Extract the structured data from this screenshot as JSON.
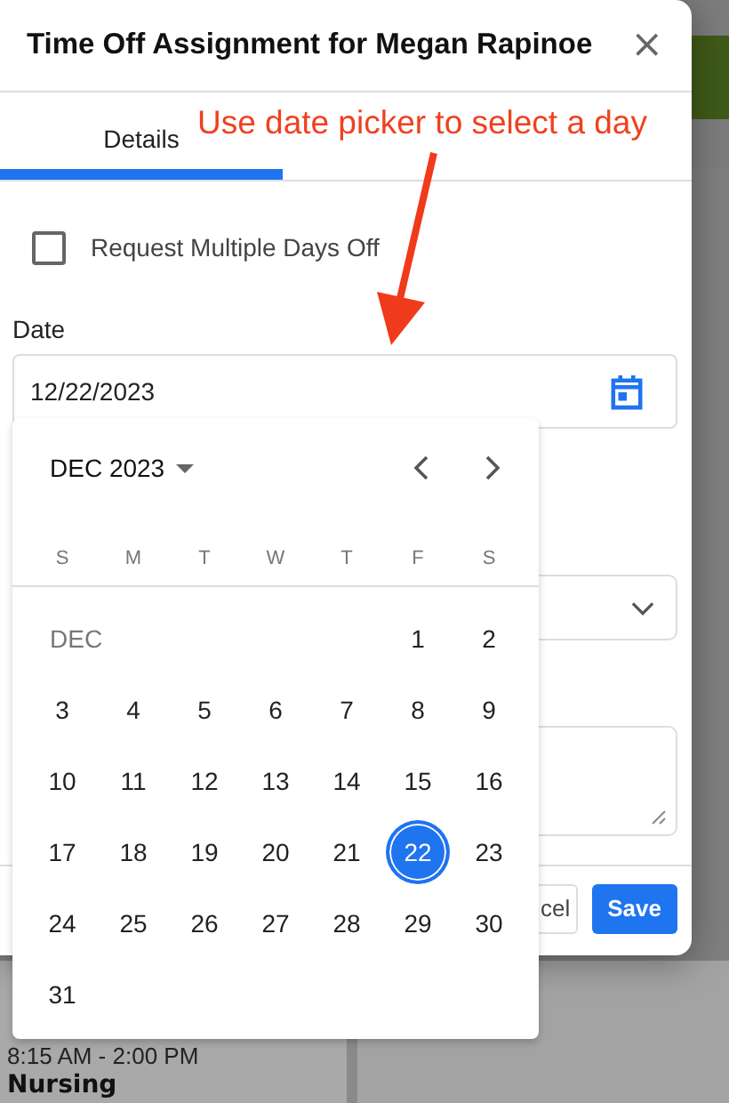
{
  "dialog": {
    "title": "Time Off Assignment for Megan Rapinoe",
    "close": "×",
    "tabs": [
      {
        "label": "Details",
        "selected": true
      }
    ],
    "checkbox": {
      "label": "Request Multiple Days Off",
      "checked": false
    },
    "date_field": {
      "label": "Date",
      "value": "12/22/2023"
    },
    "buttons": [
      {
        "label": "cel",
        "kind": "secondary"
      },
      {
        "label": "Save",
        "kind": "primary"
      }
    ]
  },
  "date_picker": {
    "month_label": "DEC 2023",
    "weekdays": [
      "S",
      "M",
      "T",
      "W",
      "T",
      "F",
      "S"
    ],
    "weeks": [
      {
        "month_label": "DEC",
        "days": [
          {
            "label": "1",
            "selected": false
          },
          {
            "label": "2",
            "selected": false
          }
        ]
      },
      {
        "days": [
          {
            "label": "3",
            "selected": false
          },
          {
            "label": "4",
            "selected": false
          },
          {
            "label": "5",
            "selected": false
          },
          {
            "label": "6",
            "selected": false
          },
          {
            "label": "7",
            "selected": false
          },
          {
            "label": "8",
            "selected": false
          },
          {
            "label": "9",
            "selected": false
          }
        ]
      },
      {
        "days": [
          {
            "label": "10",
            "selected": false
          },
          {
            "label": "11",
            "selected": false
          },
          {
            "label": "12",
            "selected": false
          },
          {
            "label": "13",
            "selected": false
          },
          {
            "label": "14",
            "selected": false
          },
          {
            "label": "15",
            "selected": false
          },
          {
            "label": "16",
            "selected": false
          }
        ]
      },
      {
        "days": [
          {
            "label": "17",
            "selected": false
          },
          {
            "label": "18",
            "selected": false
          },
          {
            "label": "19",
            "selected": false
          },
          {
            "label": "20",
            "selected": false
          },
          {
            "label": "21",
            "selected": false
          },
          {
            "label": "22",
            "selected": true
          },
          {
            "label": "23",
            "selected": false
          }
        ]
      },
      {
        "days": [
          {
            "label": "24",
            "selected": false
          },
          {
            "label": "25",
            "selected": false
          },
          {
            "label": "26",
            "selected": false
          },
          {
            "label": "27",
            "selected": false
          },
          {
            "label": "28",
            "selected": false
          },
          {
            "label": "29",
            "selected": false
          },
          {
            "label": "30",
            "selected": false
          }
        ]
      },
      {
        "days": [
          {
            "label": "31",
            "selected": false
          }
        ]
      }
    ]
  },
  "annotation": {
    "text": "Use date picker to select a day"
  },
  "background": {
    "shift": {
      "time": "8:15 AM - 2:00 PM",
      "department": "Nursing"
    }
  }
}
